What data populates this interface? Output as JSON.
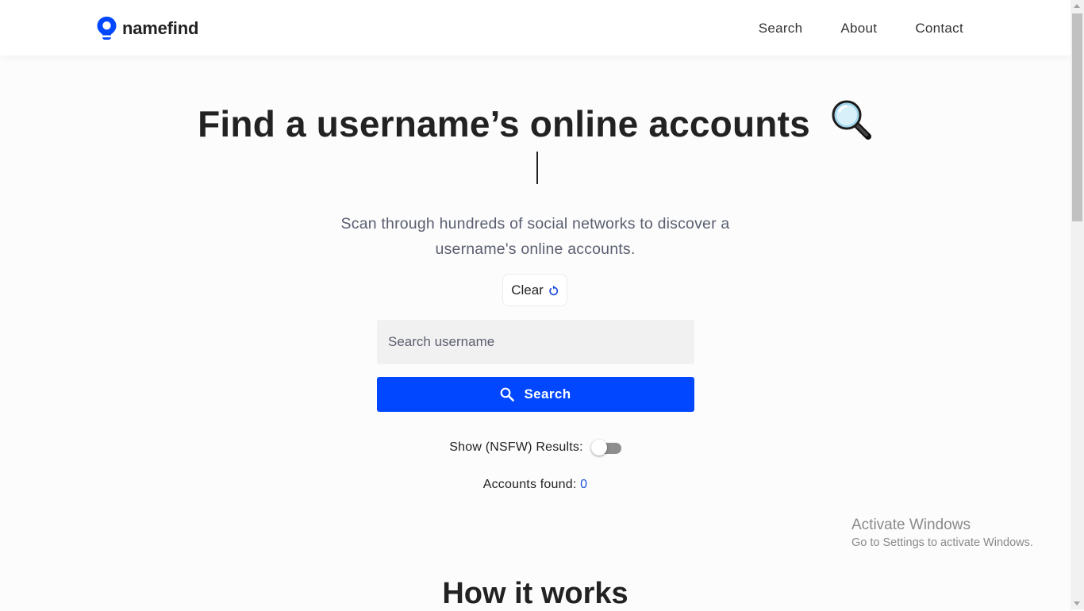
{
  "brand": {
    "name": "namefind",
    "accent": "#0047ff"
  },
  "nav": {
    "items": [
      "Search",
      "About",
      "Contact"
    ]
  },
  "hero": {
    "title": "Find a username’s online accounts",
    "title_icon": "magnifying-glass-emoji",
    "subtitle": "Scan through hundreds of social networks to discover a username's online accounts."
  },
  "controls": {
    "clear_label": "Clear",
    "clear_icon": "refresh-icon",
    "search_placeholder": "Search username",
    "search_value": "",
    "search_button_label": "Search",
    "search_button_icon": "search-icon",
    "nsfw_label": "Show (NSFW) Results:",
    "nsfw_enabled": false,
    "accounts_label": "Accounts found:",
    "accounts_count": "0"
  },
  "sections": {
    "how_title": "How it works"
  },
  "watermark": {
    "line1": "Activate Windows",
    "line2": "Go to Settings to activate Windows."
  }
}
